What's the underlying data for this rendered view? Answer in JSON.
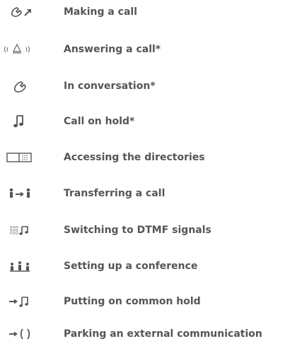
{
  "items": [
    {
      "icon": "handset-outgoing-icon",
      "label": "Making a call"
    },
    {
      "icon": "ringing-bell-icon",
      "label": "Answering a call*"
    },
    {
      "icon": "handset-icon",
      "label": "In conversation*"
    },
    {
      "icon": "music-note-icon",
      "label": "Call on hold*"
    },
    {
      "icon": "directory-book-icon",
      "label": "Accessing the directories"
    },
    {
      "icon": "transfer-persons-icon",
      "label": "Transferring a call"
    },
    {
      "icon": "dtmf-keypad-icon",
      "label": "Switching to DTMF signals"
    },
    {
      "icon": "conference-icon",
      "label": "Setting up a conference"
    },
    {
      "icon": "common-hold-icon",
      "label": "Putting on common hold"
    },
    {
      "icon": "park-call-icon",
      "label": "Parking an external communication"
    }
  ]
}
